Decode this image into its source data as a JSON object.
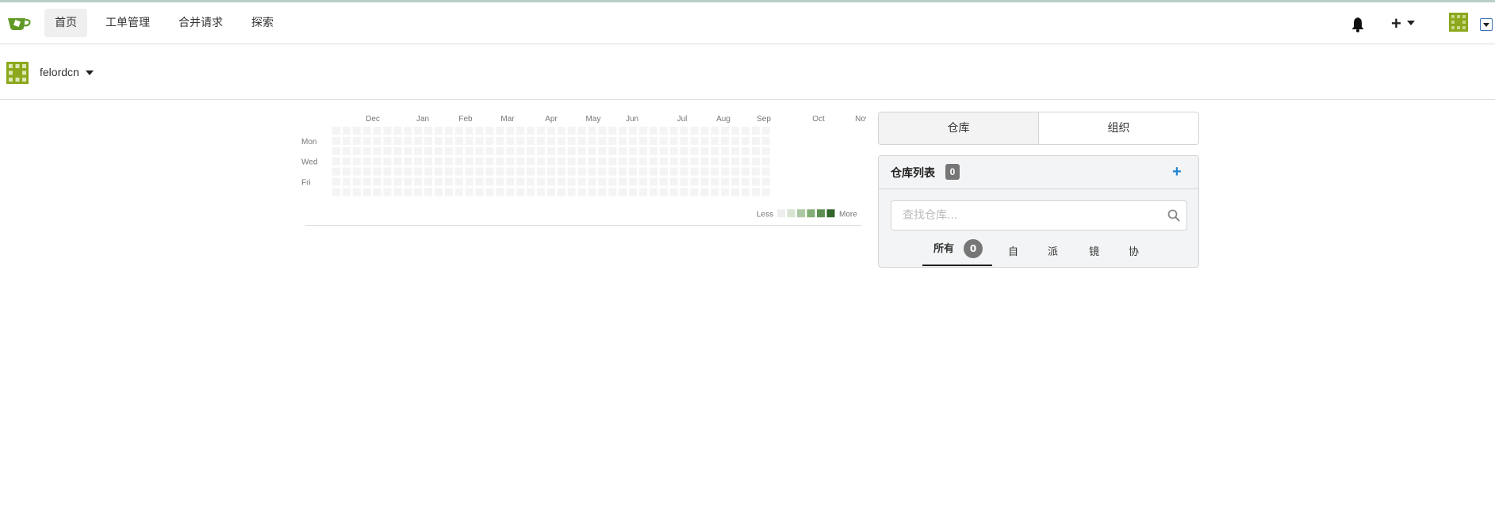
{
  "nav": {
    "items": [
      {
        "label": "首页",
        "active": true
      },
      {
        "label": "工单管理",
        "active": false
      },
      {
        "label": "合并请求",
        "active": false
      },
      {
        "label": "探索",
        "active": false
      }
    ]
  },
  "context": {
    "username": "felordcn"
  },
  "heatmap": {
    "months": [
      "Dec",
      "Jan",
      "Feb",
      "Mar",
      "Apr",
      "May",
      "Jun",
      "Jul",
      "Aug",
      "Sep",
      "Oct",
      "Nov"
    ],
    "days": [
      "Mon",
      "Wed",
      "Fri"
    ],
    "legend_less": "Less",
    "legend_more": "More",
    "legend_colors": [
      "#eeeeee",
      "#d6e4d1",
      "#acc8a3",
      "#82ad75",
      "#5d8d50",
      "#33662a"
    ],
    "empty_color": "#f4f4f4"
  },
  "panel": {
    "tabs": [
      {
        "label": "仓库",
        "active": true
      },
      {
        "label": "组织",
        "active": false
      }
    ],
    "repo_title": "仓库列表",
    "repo_count": "0",
    "add_symbol": "+",
    "search_placeholder": "查找仓库...",
    "filters": [
      {
        "label": "所有",
        "count": "0",
        "active": true
      },
      {
        "label": "自建"
      },
      {
        "label": "派生"
      },
      {
        "label": "镜像"
      },
      {
        "label": "协作"
      }
    ]
  },
  "colors": {
    "accent": "#2185d0",
    "logo_green": "#609926",
    "avatar_green": "#8ca81c"
  }
}
